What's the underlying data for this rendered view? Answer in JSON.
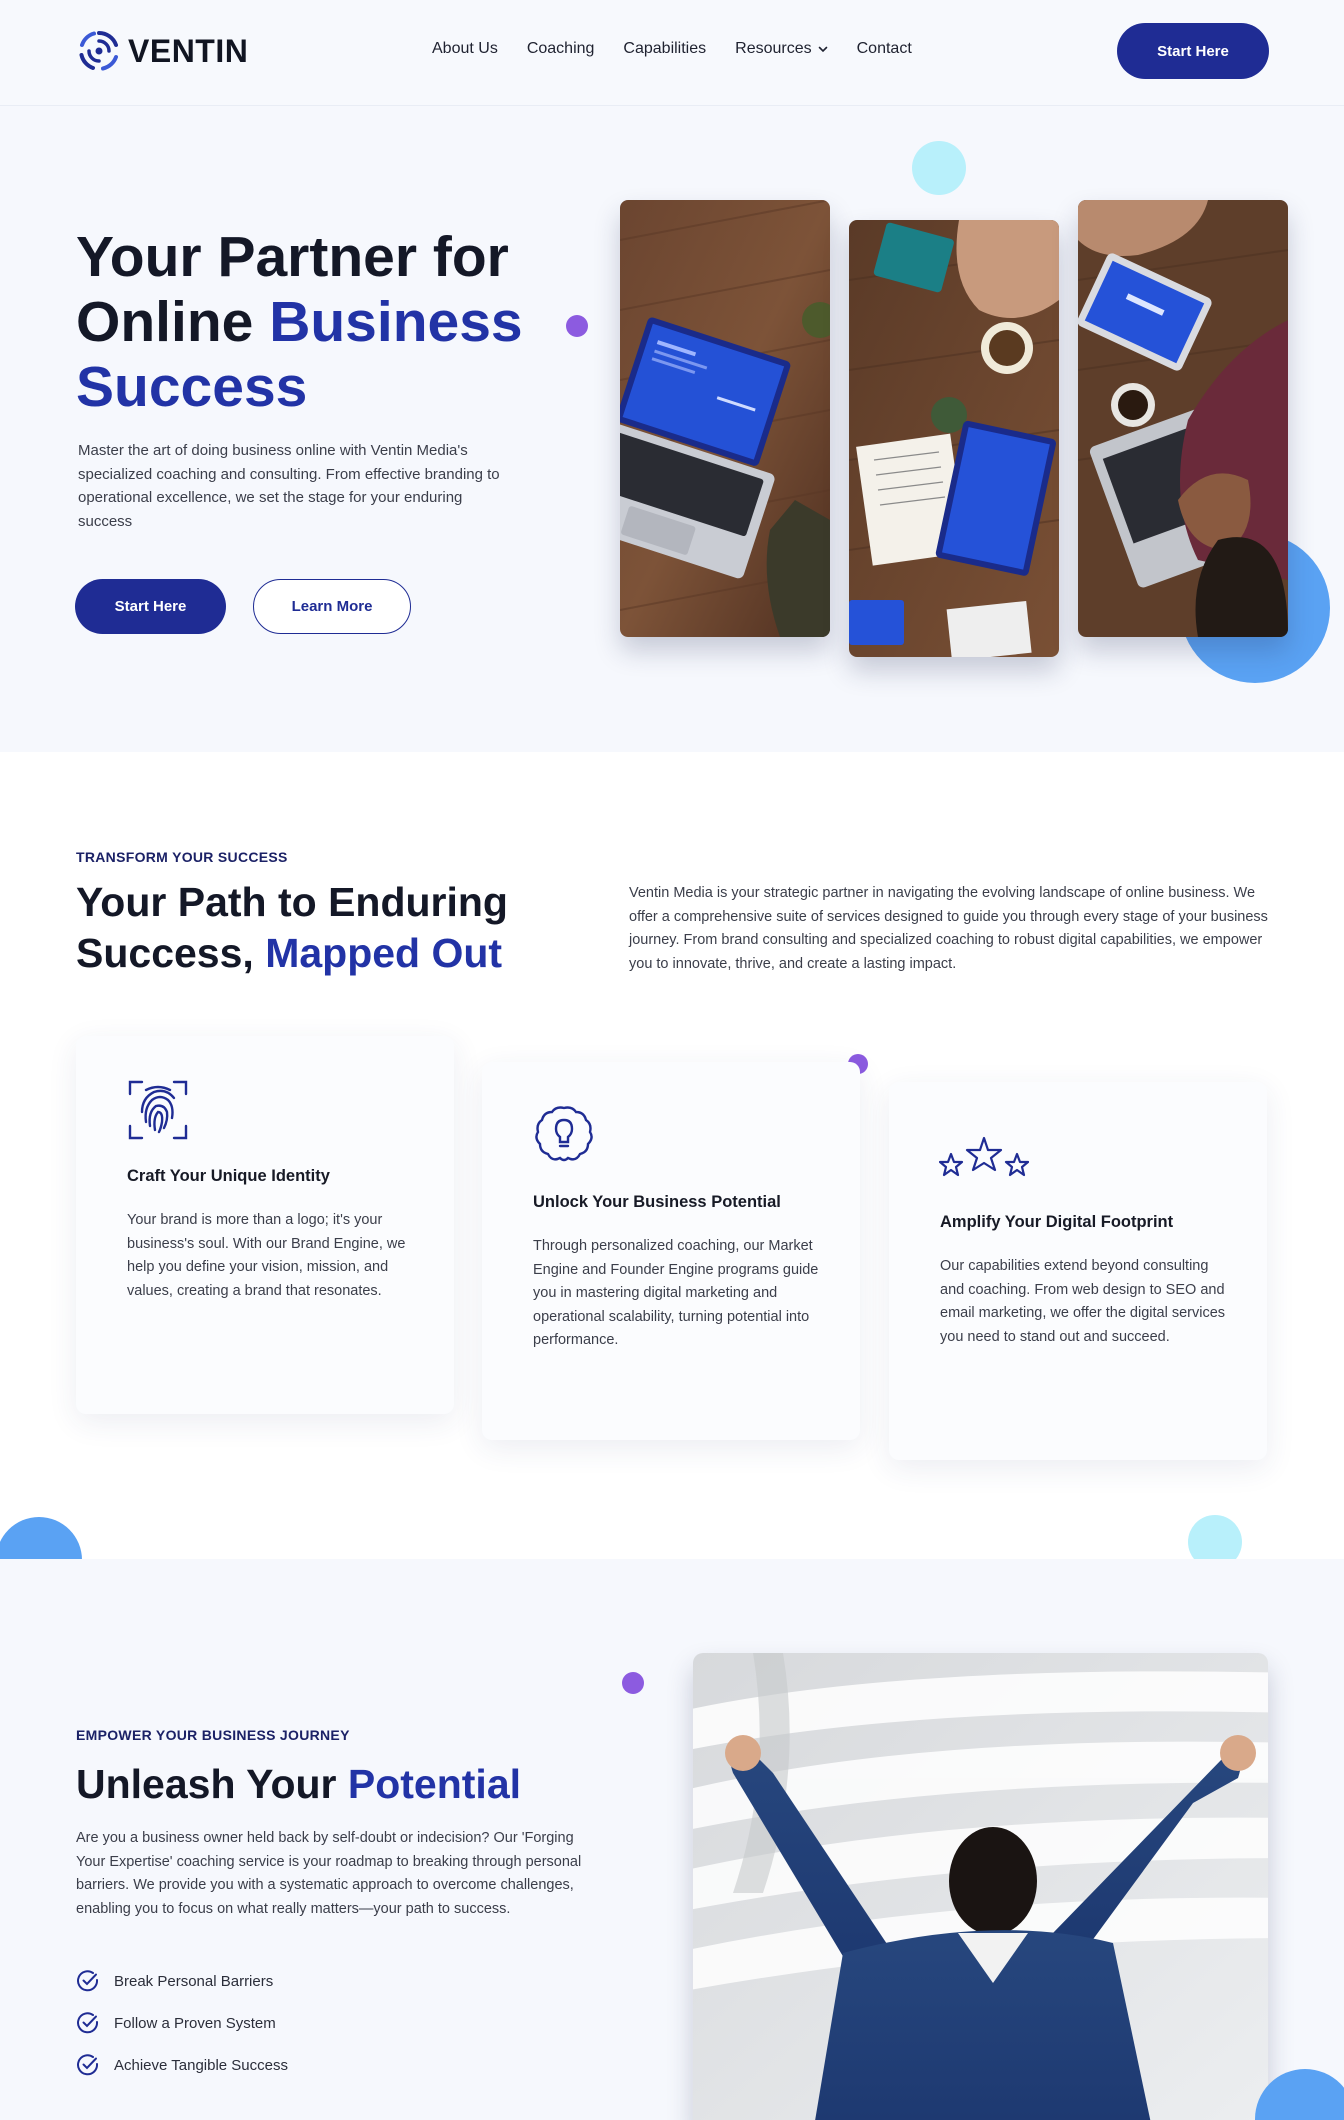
{
  "brand": {
    "name": "VENTIN",
    "accent_color": "#2233a6",
    "button_color": "#1f2c94"
  },
  "nav": {
    "items": [
      "About Us",
      "Coaching",
      "Capabilities",
      "Resources",
      "Contact"
    ],
    "cta_label": "Start Here"
  },
  "hero": {
    "title_line1": "Your Partner for",
    "title_line2_plain": "Online ",
    "title_line2_accent": "Business",
    "title_line3_accent": "Success",
    "body": "Master the art of doing business online with Ventin Media's specialized coaching and consulting. From effective branding to operational excellence, we set the stage for your enduring success",
    "primary_button": "Start Here",
    "secondary_button": "Learn More"
  },
  "path_section": {
    "eyebrow": "TRANSFORM YOUR SUCCESS",
    "title_line1": "Your Path to Enduring",
    "title_line2_plain": "Success, ",
    "title_line2_accent": "Mapped Out",
    "body": "Ventin Media is your strategic partner in navigating the evolving landscape of online business. We offer a comprehensive suite of services designed to guide you through every stage of your business journey. From brand consulting and specialized coaching to robust digital capabilities, we empower you to innovate, thrive, and create a lasting impact.",
    "cards": [
      {
        "icon": "fingerprint-icon",
        "title": "Craft Your Unique Identity",
        "body": "Your brand is more than a logo; it's your business's soul. With our Brand Engine, we help you define your vision, mission, and values, creating a brand that resonates."
      },
      {
        "icon": "brain-lightbulb-icon",
        "title": "Unlock Your Business Potential",
        "body": "Through personalized coaching, our Market Engine and Founder Engine programs guide you in mastering digital marketing and operational scalability, turning potential into performance."
      },
      {
        "icon": "stars-icon",
        "title": "Amplify Your Digital Footprint",
        "body": "Our capabilities extend beyond consulting and coaching. From web design to SEO and email marketing, we offer the digital services you need to stand out and succeed."
      }
    ]
  },
  "potential_section": {
    "eyebrow": "EMPOWER YOUR BUSINESS JOURNEY",
    "title_plain": "Unleash Your ",
    "title_accent": "Potential",
    "body": "Are you a business owner held back by self-doubt or indecision? Our 'Forging Your Expertise' coaching service is your roadmap to breaking through personal barriers. We provide you with a systematic approach to overcome challenges, enabling you to focus on what really matters—your path to success.",
    "checklist": [
      "Break Personal Barriers",
      "Follow a Proven System",
      "Achieve Tangible Success"
    ]
  }
}
